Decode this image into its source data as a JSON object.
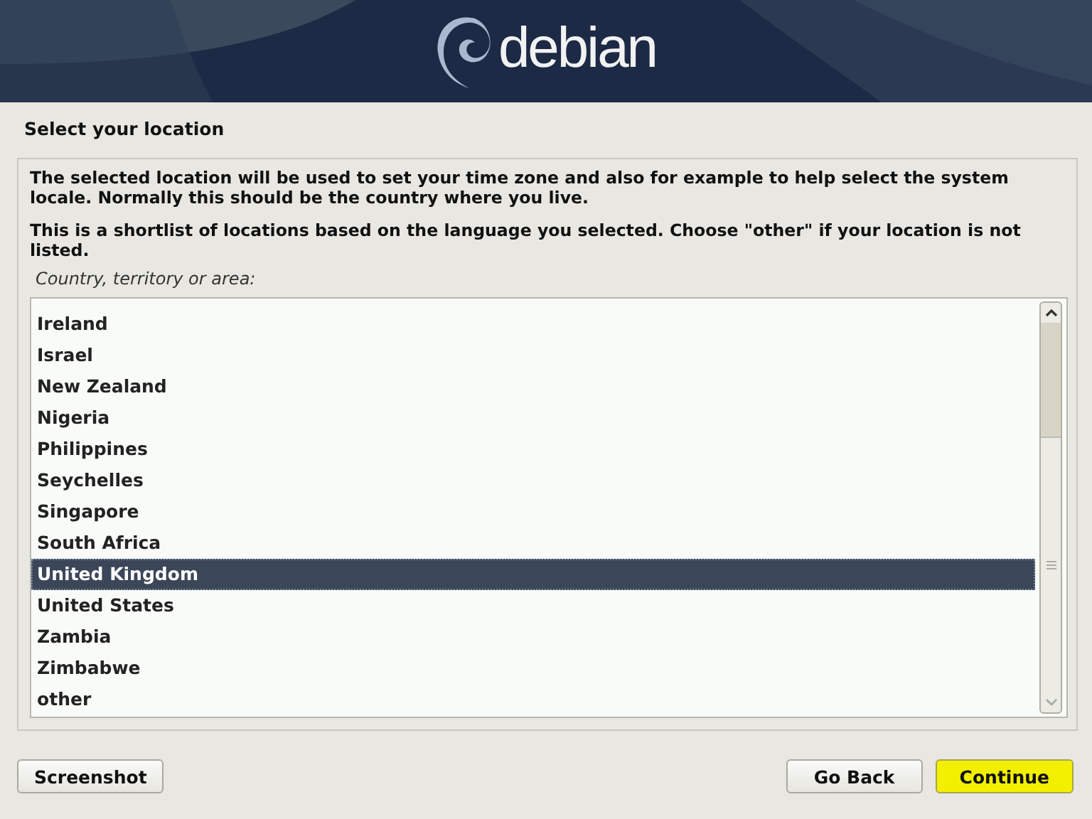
{
  "header": {
    "logo_text": "debian"
  },
  "title": "Select your location",
  "description": [
    "The selected location will be used to set your time zone and also for example to help select the system locale. Normally this should be the country where you live.",
    "This is a shortlist of locations based on the language you selected. Choose \"other\" if your location is not listed."
  ],
  "list_label": "Country, territory or area:",
  "locations": [
    {
      "label": "Ireland",
      "selected": false
    },
    {
      "label": "Israel",
      "selected": false
    },
    {
      "label": "New Zealand",
      "selected": false
    },
    {
      "label": "Nigeria",
      "selected": false
    },
    {
      "label": "Philippines",
      "selected": false
    },
    {
      "label": "Seychelles",
      "selected": false
    },
    {
      "label": "Singapore",
      "selected": false
    },
    {
      "label": "South Africa",
      "selected": false
    },
    {
      "label": "United Kingdom",
      "selected": true
    },
    {
      "label": "United States",
      "selected": false
    },
    {
      "label": "Zambia",
      "selected": false
    },
    {
      "label": "Zimbabwe",
      "selected": false
    },
    {
      "label": "other",
      "selected": false
    }
  ],
  "buttons": [
    {
      "label": "Screenshot",
      "kind": "plain"
    },
    {
      "label": "Go Back",
      "kind": "plain"
    },
    {
      "label": "Continue",
      "kind": "primary"
    }
  ]
}
